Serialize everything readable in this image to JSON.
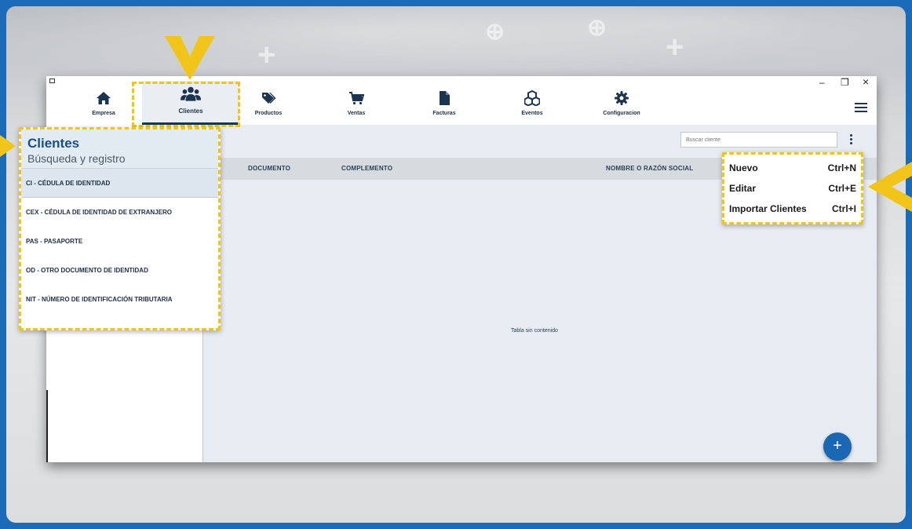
{
  "nav": {
    "items": [
      {
        "label": "Empresa",
        "icon": "home-icon"
      },
      {
        "label": "Clientes",
        "icon": "users-icon"
      },
      {
        "label": "Productos",
        "icon": "tags-icon"
      },
      {
        "label": "Ventas",
        "icon": "cart-icon"
      },
      {
        "label": "Facturas",
        "icon": "file-icon"
      },
      {
        "label": "Eventos",
        "icon": "cubes-icon"
      },
      {
        "label": "Configuracion",
        "icon": "gear-icon"
      }
    ],
    "active": "Clientes"
  },
  "window_controls": {
    "minimize": "–",
    "restore": "❐",
    "close": "×"
  },
  "search": {
    "placeholder": "Buscar cliente"
  },
  "table": {
    "columns": [
      "DOCUMENTO",
      "COMPLEMENTO",
      "NOMBRE O RAZÓN SOCIAL"
    ],
    "empty_text": "Tabla sin contenido"
  },
  "doc_panel": {
    "title": "Clientes",
    "subtitle": "Búsqueda y registro",
    "items": [
      "CI - CÉDULA DE IDENTIDAD",
      "CEX - CÉDULA DE IDENTIDAD DE EXTRANJERO",
      "PAS - PASAPORTE",
      "OD - OTRO DOCUMENTO DE IDENTIDAD",
      "NIT - NÚMERO DE IDENTIFICACIÓN TRIBUTARIA"
    ]
  },
  "context_menu": {
    "items": [
      {
        "label": "Nuevo",
        "shortcut": "Ctrl+N"
      },
      {
        "label": "Editar",
        "shortcut": "Ctrl+E"
      },
      {
        "label": "Importar Clientes",
        "shortcut": "Ctrl+I"
      }
    ]
  },
  "fab": {
    "label": "+"
  },
  "colors": {
    "accent": "#1a67b4",
    "highlight": "#f0c419",
    "navy": "#1d3450",
    "frame": "#1a6bb8"
  }
}
